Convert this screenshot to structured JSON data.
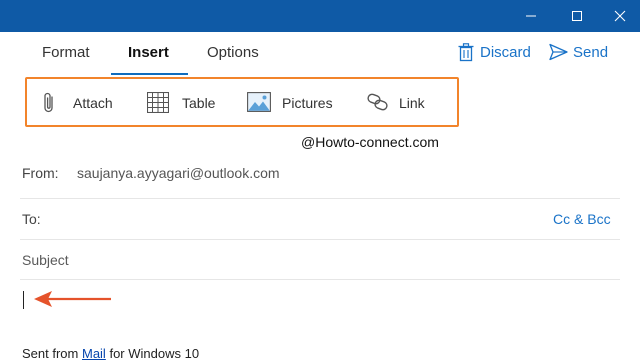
{
  "window": {
    "controls": {
      "minimize": "minimize-icon",
      "maximize": "maximize-icon",
      "close": "close-icon"
    }
  },
  "tabs": [
    {
      "label": "Format",
      "active": false
    },
    {
      "label": "Insert",
      "active": true
    },
    {
      "label": "Options",
      "active": false
    }
  ],
  "actions": {
    "discard": {
      "label": "Discard",
      "icon": "trash-icon"
    },
    "send": {
      "label": "Send",
      "icon": "send-icon"
    }
  },
  "ribbon": {
    "highlight_color": "#f2842b",
    "items": [
      {
        "label": "Attach",
        "icon": "paperclip-icon"
      },
      {
        "label": "Table",
        "icon": "table-icon"
      },
      {
        "label": "Pictures",
        "icon": "picture-icon"
      },
      {
        "label": "Link",
        "icon": "link-icon"
      }
    ]
  },
  "watermark": "@Howto-connect.com",
  "compose": {
    "from_label": "From:",
    "from_value": "saujanya.ayyagari@outlook.com",
    "to_label": "To:",
    "cc_bcc": "Cc & Bcc",
    "subject_placeholder": "Subject",
    "signature_prefix": "Sent from",
    "signature_link": "Mail",
    "signature_suffix": "for Windows 10"
  },
  "colors": {
    "titlebar": "#0f5aa6",
    "accent": "#1a73c8",
    "annotation_arrow": "#e5532b"
  }
}
